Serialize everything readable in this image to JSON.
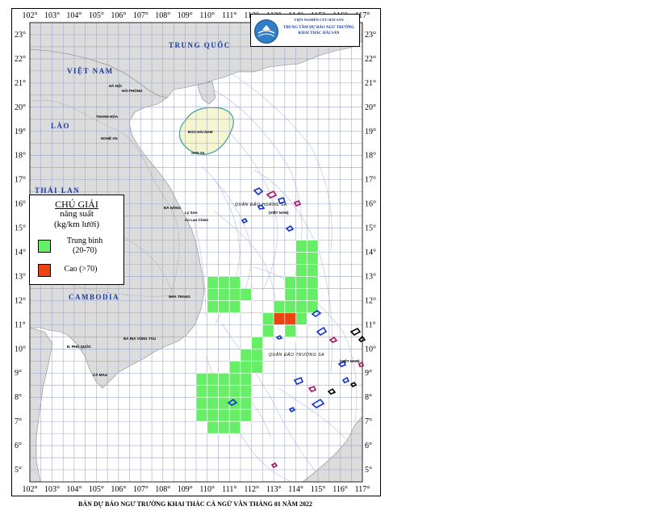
{
  "map": {
    "lon_ticks": [
      "102°",
      "103°",
      "104°",
      "105°",
      "106°",
      "107°",
      "108°",
      "109°",
      "110°",
      "111°",
      "112°",
      "113°",
      "114°",
      "115°",
      "116°",
      "117°"
    ],
    "lat_ticks": [
      "23°",
      "22°",
      "21°",
      "20°",
      "19°",
      "18°",
      "17°",
      "16°",
      "15°",
      "14°",
      "13°",
      "12°",
      "11°",
      "10°",
      "9°",
      "8°",
      "7°",
      "6°",
      "5°"
    ],
    "countries": {
      "china": "TRUNG QUỐC",
      "vietnam": "VIỆT NAM",
      "laos": "LÀO",
      "thailand": "THÁI LAN",
      "cambodia": "CAMBODIA"
    },
    "places": {
      "hanoi": "HÀ NỘI",
      "haiphong": "HẢI PHÒNG",
      "thanhhoa": "THANH HÓA",
      "nghean": "NGHỆ AN",
      "danang": "ĐÀ NẴNG",
      "nhatrang": "NHA TRANG",
      "vungtau": "BÀ RỊA VŨNG TÀU",
      "phuquoc": "Đ. PHÚ QUỐC",
      "camau": "CÀ MAU",
      "hainan": "ĐẢO HẢI NAM",
      "sanya": "SAN YA",
      "lyson": "Lý Sơn",
      "cuulaocham": "Cù Lao Chàm"
    },
    "islands": {
      "hoangsa": "QUẦN ĐẢO HOÀNG SA",
      "hoangsa_vn": "(VIỆT NAM)",
      "truongsa": "QUẦN ĐẢO TRƯỜNG SA",
      "truongsa_vn": "(VIỆT NAM)"
    },
    "grid_deg": 1,
    "lon_range": [
      102,
      117
    ],
    "lat_range": [
      4.5,
      23.5
    ]
  },
  "logo": {
    "line1": "VIỆN NGHIÊN CỨU HẢI SẢN",
    "line2": "TRUNG TÂM DỰ BÁO NGƯ TRƯỜNG KHAI THÁC HẢI SẢN"
  },
  "legend": {
    "title": "CHÚ GIẢI",
    "sub1": "năng suất",
    "sub2": "(kg/km lưới)",
    "medium_label": "Trung bình",
    "medium_range": "(20-70)",
    "high_label": "Cao (>70)",
    "medium_color": "#66ee66",
    "high_color": "#ee4411"
  },
  "forecast_cells": {
    "medium": [
      [
        114,
        14
      ],
      [
        114.5,
        14
      ],
      [
        114,
        13.5
      ],
      [
        114.5,
        13.5
      ],
      [
        114,
        13
      ],
      [
        114.5,
        13
      ],
      [
        113.5,
        12.5
      ],
      [
        114,
        12.5
      ],
      [
        114.5,
        12.5
      ],
      [
        113.5,
        12
      ],
      [
        114,
        12
      ],
      [
        114.5,
        12
      ],
      [
        113,
        11.5
      ],
      [
        113.5,
        11.5
      ],
      [
        114,
        11.5
      ],
      [
        114.5,
        11.5
      ],
      [
        112.5,
        11
      ],
      [
        113,
        11
      ],
      [
        113.5,
        11
      ],
      [
        114,
        11
      ],
      [
        112.5,
        10.5
      ],
      [
        113.5,
        10.5
      ],
      [
        110,
        12.5
      ],
      [
        110.5,
        12.5
      ],
      [
        111,
        12.5
      ],
      [
        110,
        12
      ],
      [
        110.5,
        12
      ],
      [
        111,
        12
      ],
      [
        111.5,
        12
      ],
      [
        110,
        11.5
      ],
      [
        110.5,
        11.5
      ],
      [
        111,
        11.5
      ],
      [
        112,
        10
      ],
      [
        111.5,
        9.5
      ],
      [
        112,
        9.5
      ],
      [
        111,
        9
      ],
      [
        111.5,
        9
      ],
      [
        112,
        9
      ],
      [
        109.5,
        8.5
      ],
      [
        110,
        8.5
      ],
      [
        110.5,
        8.5
      ],
      [
        111,
        8.5
      ],
      [
        111.5,
        8.5
      ],
      [
        109.5,
        8
      ],
      [
        110,
        8
      ],
      [
        110.5,
        8
      ],
      [
        111,
        8
      ],
      [
        111.5,
        8
      ],
      [
        109.5,
        7.5
      ],
      [
        110,
        7.5
      ],
      [
        110.5,
        7.5
      ],
      [
        111,
        7.5
      ],
      [
        111.5,
        7.5
      ],
      [
        109.5,
        7
      ],
      [
        110,
        7
      ],
      [
        110.5,
        7
      ],
      [
        111,
        7
      ],
      [
        111.5,
        7
      ],
      [
        110,
        6.5
      ],
      [
        110.5,
        6.5
      ],
      [
        111,
        6.5
      ]
    ],
    "high": [
      [
        113,
        11
      ],
      [
        113.5,
        11
      ]
    ]
  },
  "caption": "BẢN DỰ BÁO NGƯ TRƯỜNG KHAI THÁC CÁ NGỪ VẰN THÁNG 01 NĂM 2022"
}
